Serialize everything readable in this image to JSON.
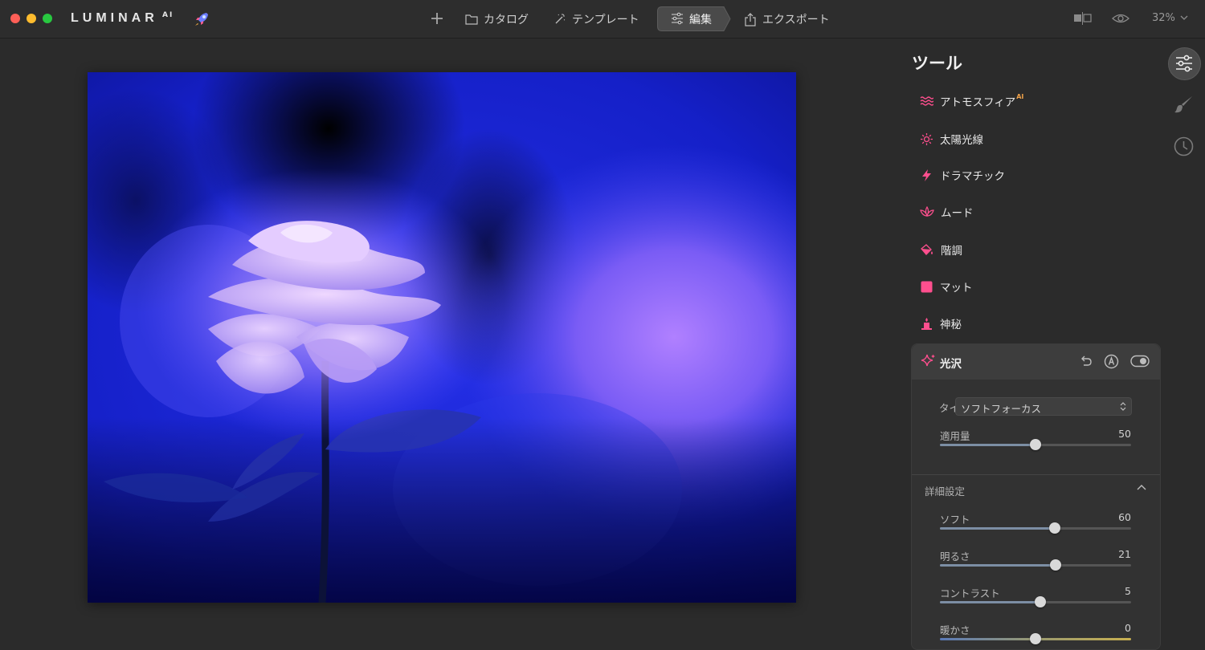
{
  "app": {
    "brand": "LUMINAR",
    "brand_sup": "AI"
  },
  "nav": {
    "catalog": "カタログ",
    "template": "テンプレート",
    "edit": "編集",
    "export": "エクスポート"
  },
  "toolbar": {
    "zoom": "32%"
  },
  "panel": {
    "title": "ツール",
    "tools": [
      {
        "label": "アトモスフィア",
        "badge": "AI",
        "icon": "waves-icon"
      },
      {
        "label": "太陽光線",
        "icon": "sun-icon"
      },
      {
        "label": "ドラマチック",
        "icon": "lightning-icon"
      },
      {
        "label": "ムード",
        "icon": "lotus-icon"
      },
      {
        "label": "階調",
        "icon": "paint-bucket-icon"
      },
      {
        "label": "マット",
        "icon": "square-icon"
      },
      {
        "label": "神秘",
        "icon": "candle-icon"
      }
    ],
    "active_tool": {
      "label": "光沢",
      "icon": "sparkle-icon",
      "type_label": "タイプ:",
      "type_value": "ソフトフォーカス",
      "amount": {
        "label": "適用量",
        "value": 50,
        "min": 0,
        "max": 100
      },
      "advanced_label": "詳細設定",
      "advanced": [
        {
          "label": "ソフト",
          "value": 60,
          "min": 0,
          "max": 100
        },
        {
          "label": "明るさ",
          "value": 21,
          "min": -100,
          "max": 100
        },
        {
          "label": "コントラスト",
          "value": 5,
          "min": -100,
          "max": 100
        },
        {
          "label": "暖かさ",
          "value": 0,
          "min": -100,
          "max": 100
        }
      ]
    }
  },
  "colors": {
    "accent": "#ff4f8e",
    "panel_bg": "#2b2b2b",
    "photo_blue": "#1f2be0"
  }
}
